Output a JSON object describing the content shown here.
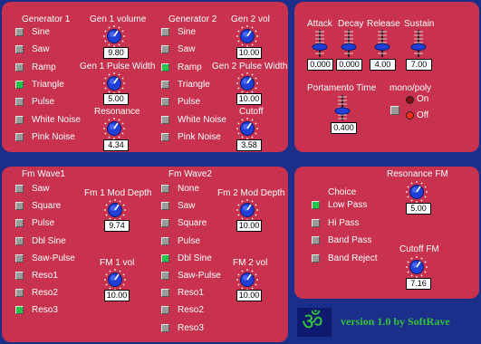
{
  "generator1": {
    "title": "Generator 1",
    "waveforms": [
      {
        "label": "Sine",
        "on": false
      },
      {
        "label": "Saw",
        "on": false
      },
      {
        "label": "Ramp",
        "on": false
      },
      {
        "label": "Triangle",
        "on": true
      },
      {
        "label": "Pulse",
        "on": false
      },
      {
        "label": "White Noise",
        "on": false
      },
      {
        "label": "Pink Noise",
        "on": false
      }
    ],
    "volume_label": "Gen 1 volume",
    "volume_value": "9.80",
    "pulse_width_label": "Gen 1 Pulse Width",
    "pulse_width_value": "5.00",
    "resonance_label": "Resonance",
    "resonance_value": "4.34"
  },
  "generator2": {
    "title": "Generator 2",
    "waveforms": [
      {
        "label": "Sine",
        "on": false
      },
      {
        "label": "Saw",
        "on": false
      },
      {
        "label": "Ramp",
        "on": true
      },
      {
        "label": "Triangle",
        "on": false
      },
      {
        "label": "Pulse",
        "on": false
      },
      {
        "label": "White Noise",
        "on": false
      },
      {
        "label": "Pink Noise",
        "on": false
      }
    ],
    "volume_label": "Gen 2 vol",
    "volume_value": "10.00",
    "pulse_width_label": "Gen 2 Pulse Width",
    "pulse_width_value": "10.00",
    "cutoff_label": "Cutoff",
    "cutoff_value": "3.58"
  },
  "envelope": {
    "attack_label": "Attack",
    "attack_value": "0.000",
    "decay_label": "Decay",
    "decay_value": "0.000",
    "release_label": "Release",
    "release_value": "4.00",
    "sustain_label": "Sustain",
    "sustain_value": "7.00",
    "portamento_label": "Portamento Time",
    "portamento_value": "0.400",
    "monopoly_label": "mono/poly",
    "on_label": "On",
    "off_label": "Off"
  },
  "fm1": {
    "title": "Fm Wave1",
    "waves": [
      {
        "label": "Saw",
        "on": false
      },
      {
        "label": "Square",
        "on": false
      },
      {
        "label": "Pulse",
        "on": false
      },
      {
        "label": "Dbl Sine",
        "on": false
      },
      {
        "label": "Saw-Pulse",
        "on": false
      },
      {
        "label": "Reso1",
        "on": false
      },
      {
        "label": "Reso2",
        "on": false
      },
      {
        "label": "Reso3",
        "on": true
      }
    ],
    "depth_label": "Fm 1 Mod Depth",
    "depth_value": "9.74",
    "vol_label": "FM 1 vol",
    "vol_value": "10.00"
  },
  "fm2": {
    "title": "Fm Wave2",
    "waves": [
      {
        "label": "None",
        "on": false
      },
      {
        "label": "Saw",
        "on": false
      },
      {
        "label": "Square",
        "on": false
      },
      {
        "label": "Pulse",
        "on": false
      },
      {
        "label": "Dbl Sine",
        "on": true
      },
      {
        "label": "Saw-Pulse",
        "on": false
      },
      {
        "label": "Reso1",
        "on": false
      },
      {
        "label": "Reso2",
        "on": false
      },
      {
        "label": "Reso3",
        "on": false
      }
    ],
    "depth_label": "Fm 2 Mod Depth",
    "depth_value": "10.00",
    "vol_label": "FM 2 vol",
    "vol_value": "10.00"
  },
  "filter": {
    "choice_label": "Choice",
    "options": [
      {
        "label": "Low Pass",
        "on": true
      },
      {
        "label": "Hi Pass",
        "on": false
      },
      {
        "label": "Band Pass",
        "on": false
      },
      {
        "label": "Band Reject",
        "on": false
      }
    ],
    "resonance_label": "Resonance FM",
    "resonance_value": "5.00",
    "cutoff_label": "Cutoff FM",
    "cutoff_value": "7.16"
  },
  "footer": {
    "version": "version 1.0 by SoftRave",
    "logo_glyph": "ॐ"
  },
  "colors": {
    "panel": "#c9324f",
    "background": "#1b2e8a",
    "led_on": "#22c44a",
    "led_off": "#9a9a9a",
    "knob": "#1f3fd6"
  }
}
